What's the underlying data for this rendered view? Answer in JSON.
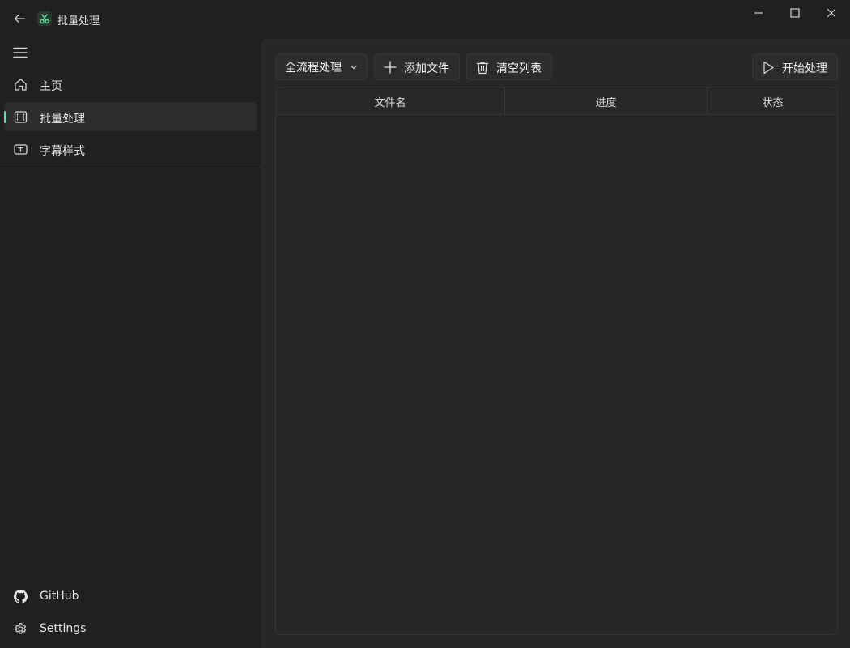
{
  "window": {
    "title": "批量处理",
    "icons": {
      "back": "back-arrow-icon",
      "app": "scissors-icon",
      "minimize": "minimize-icon",
      "maximize": "maximize-icon",
      "close": "close-icon"
    }
  },
  "sidebar": {
    "items": [
      {
        "label": "主页",
        "icon": "home-icon"
      },
      {
        "label": "批量处理",
        "icon": "film-icon",
        "active": true
      },
      {
        "label": "字幕样式",
        "icon": "subtitle-icon"
      }
    ],
    "footer": [
      {
        "label": "GitHub",
        "icon": "github-icon"
      },
      {
        "label": "Settings",
        "icon": "gear-icon"
      }
    ]
  },
  "toolbar": {
    "mode_selected": "全流程处理",
    "add_label": "添加文件",
    "clear_label": "清空列表",
    "start_label": "开始处理"
  },
  "table": {
    "columns": [
      "文件名",
      "进度",
      "状态"
    ],
    "rows": []
  },
  "colors": {
    "accent": "#4fe8a4",
    "background": "#202020",
    "panel": "#272727"
  }
}
